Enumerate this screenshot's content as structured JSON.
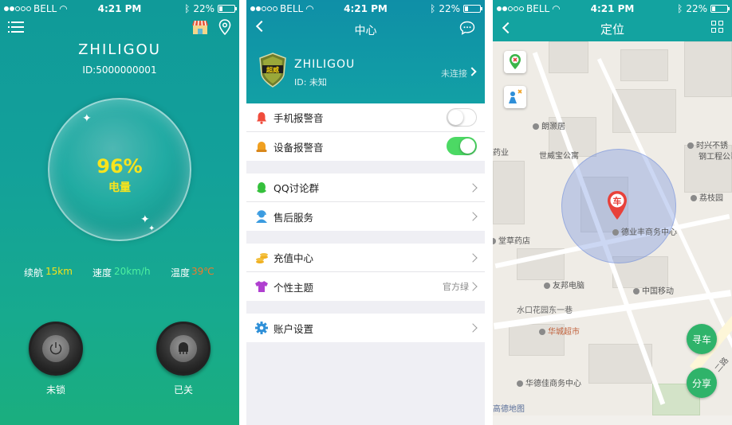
{
  "status_bar": {
    "carrier": "BELL",
    "time": "4:21 PM",
    "battery": "22%"
  },
  "home": {
    "device_name": "ZHILIGOU",
    "device_id": "ID:5000000001",
    "battery_percent": "96%",
    "battery_label": "电量",
    "stats": [
      {
        "label": "续航",
        "value": "15km",
        "color": "#f5e31a"
      },
      {
        "label": "速度",
        "value": "20km/h",
        "color": "#4ef0a0"
      },
      {
        "label": "温度",
        "value": "39℃",
        "color": "#f07a2a"
      }
    ],
    "lock_label": "未锁",
    "seat_label": "已关"
  },
  "center": {
    "title": "中心",
    "badge_text": "超威",
    "user_name": "ZHILIGOU",
    "user_id": "ID: 未知",
    "connection_status": "未连接",
    "groups": [
      [
        {
          "label": "手机报警音",
          "icon": "bell-icon",
          "icon_color": "#f04c3c",
          "toggle": false
        },
        {
          "label": "设备报警音",
          "icon": "siren-icon",
          "icon_color": "#f0a020",
          "toggle": true
        }
      ],
      [
        {
          "label": "QQ讨论群",
          "icon": "qq-icon",
          "icon_color": "#35c03c"
        },
        {
          "label": "售后服务",
          "icon": "support-icon",
          "icon_color": "#3a9be0"
        }
      ],
      [
        {
          "label": "充值中心",
          "icon": "coins-icon",
          "icon_color": "#f0b020"
        },
        {
          "label": "个性主题",
          "icon": "shirt-icon",
          "icon_color": "#b040d0",
          "value": "官方绿"
        }
      ],
      [
        {
          "label": "账户设置",
          "icon": "gear-icon",
          "icon_color": "#2f90d8"
        }
      ]
    ]
  },
  "locate": {
    "title": "定位",
    "car_marker": "车",
    "pois": [
      "朗灏居",
      "世威宝公寓",
      "药业",
      "时兴不锈",
      "钢工程公司",
      "荔枝园",
      "德业丰商务中心",
      "堂草药店",
      "友邦电脑",
      "中国移动",
      "水口花园东一巷",
      "华城超市",
      "华德佳商务中心"
    ],
    "road_label": "二路",
    "find_car": "寻车",
    "share": "分享",
    "map_credit": "高德地图"
  },
  "colors": {
    "teal": "#13a3a0",
    "green_fab": "#2fb36a",
    "toggle_on": "#4cd964"
  }
}
